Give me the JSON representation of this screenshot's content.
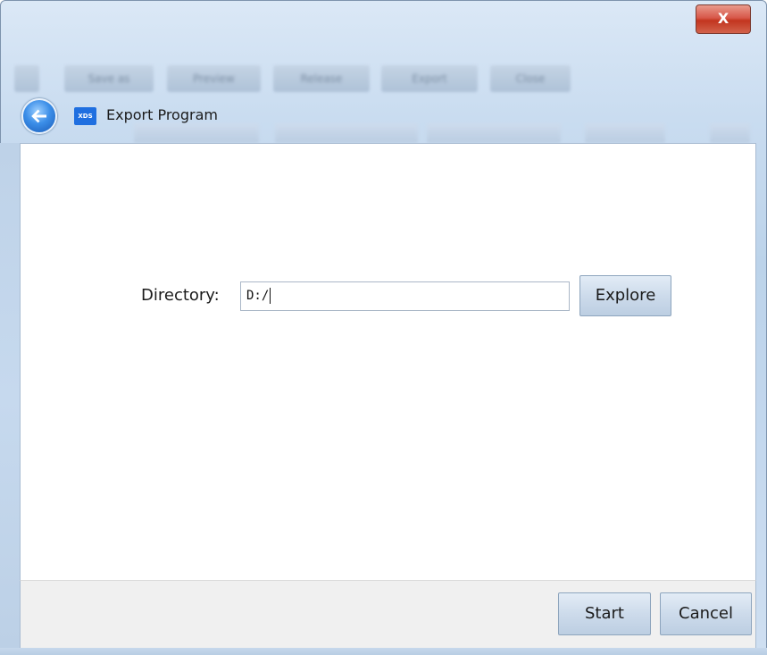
{
  "window": {
    "title": "Export Program",
    "close_label": "X",
    "app_logo_text": "XDS"
  },
  "background_toolbar": {
    "buttons": [
      "Save as",
      "Preview",
      "Release",
      "Export",
      "Close"
    ]
  },
  "form": {
    "directory_label": "Directory:",
    "directory_value": "D:/",
    "explore_label": "Explore"
  },
  "footer": {
    "start_label": "Start",
    "cancel_label": "Cancel"
  },
  "colors": {
    "accent": "#1f6fe0",
    "close_button": "#c2351f",
    "button_face": "#cddbeb"
  }
}
